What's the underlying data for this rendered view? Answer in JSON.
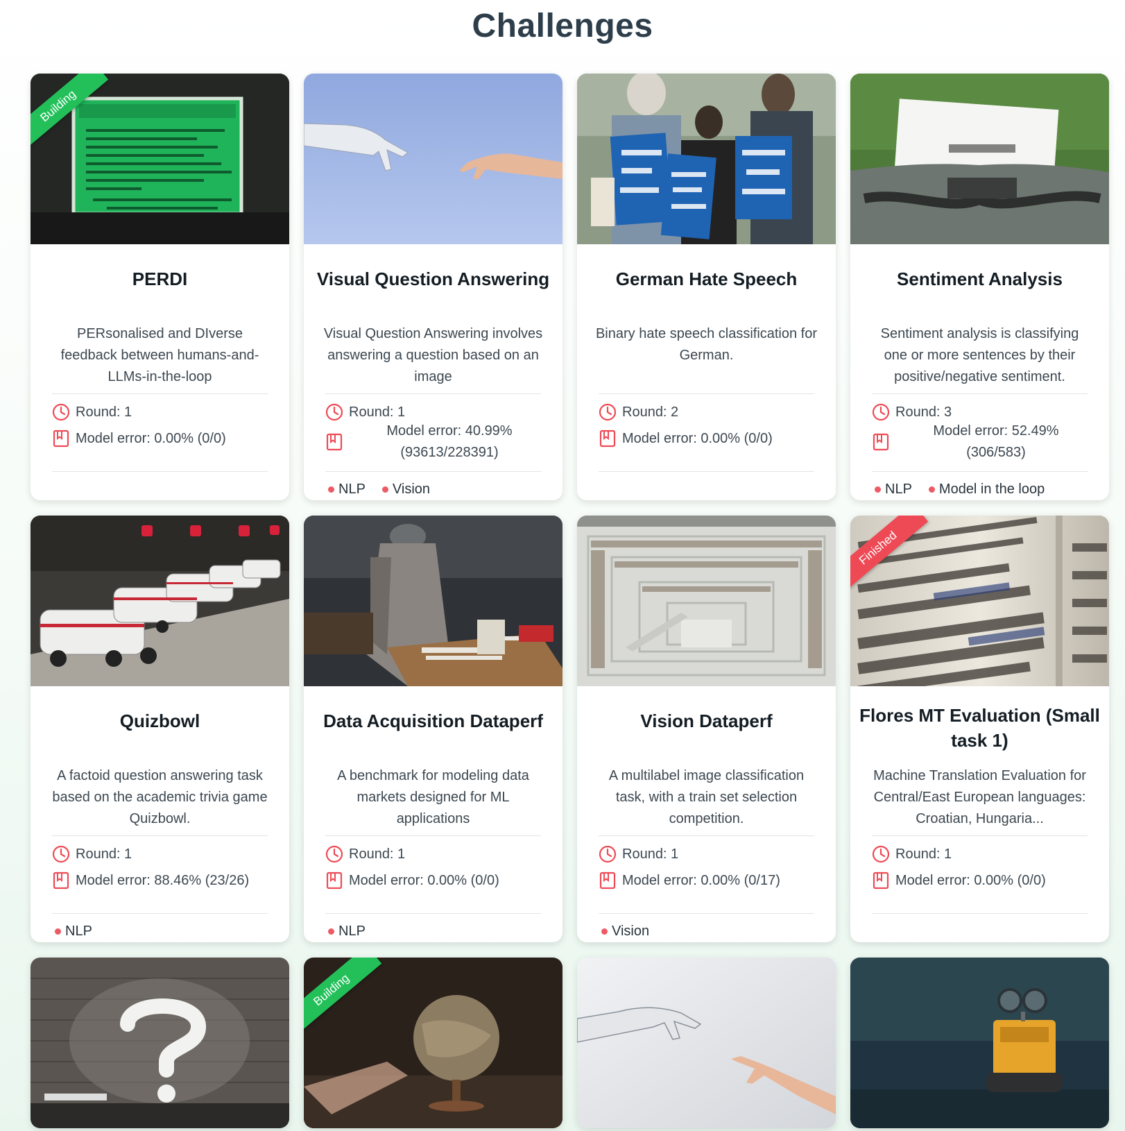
{
  "page": {
    "title": "Challenges"
  },
  "cards": [
    {
      "title": "PERDI",
      "ribbon": "Building",
      "description": "PERsonalised and DIverse feedback between humans-and-LLMs-in-the-loop",
      "round": "Round: 1",
      "model_error": "Model error: 0.00% (0/0)",
      "tags": []
    },
    {
      "title": "Visual Question Answering",
      "ribbon": "",
      "description": "Visual Question Answering involves answering a question based on an image",
      "round": "Round: 1",
      "model_error": "Model error: 40.99% (93613/228391)",
      "tags": [
        "NLP",
        "Vision"
      ]
    },
    {
      "title": "German Hate Speech",
      "ribbon": "",
      "description": "Binary hate speech classification for German.",
      "round": "Round: 2",
      "model_error": "Model error: 0.00% (0/0)",
      "tags": []
    },
    {
      "title": "Sentiment Analysis",
      "ribbon": "",
      "description": "Sentiment analysis is classifying one or more sentences by their positive/negative sentiment.",
      "round": "Round: 3",
      "model_error": "Model error: 52.49% (306/583)",
      "tags": [
        "NLP",
        "Model in the loop"
      ]
    },
    {
      "title": "Quizbowl",
      "ribbon": "",
      "description": "A factoid question answering task based on the academic trivia game Quizbowl.",
      "round": "Round: 1",
      "model_error": "Model error: 88.46% (23/26)",
      "tags": [
        "NLP"
      ]
    },
    {
      "title": "Data Acquisition Dataperf",
      "ribbon": "",
      "description": "A benchmark for modeling data markets designed for ML applications",
      "round": "Round: 1",
      "model_error": "Model error: 0.00% (0/0)",
      "tags": [
        "NLP"
      ]
    },
    {
      "title": "Vision Dataperf",
      "ribbon": "",
      "description": "A multilabel image classification task, with a train set selection competition.",
      "round": "Round: 1",
      "model_error": "Model error: 0.00% (0/17)",
      "tags": [
        "Vision"
      ]
    },
    {
      "title": "Flores MT Evaluation (Small task 1)",
      "ribbon": "Finished",
      "description": "Machine Translation Evaluation for Central/East European languages: Croatian, Hungaria...",
      "round": "Round: 1",
      "model_error": "Model error: 0.00% (0/0)",
      "tags": []
    },
    {
      "ribbon": ""
    },
    {
      "ribbon": "Building"
    },
    {
      "ribbon": ""
    },
    {
      "ribbon": ""
    }
  ],
  "colors": {
    "accent_red": "#ee4a55",
    "ribbon_green": "#23c05a",
    "tag_dot": "#ee5a63"
  },
  "icons": {
    "round": "clock-icon",
    "error": "bookmark-icon"
  }
}
